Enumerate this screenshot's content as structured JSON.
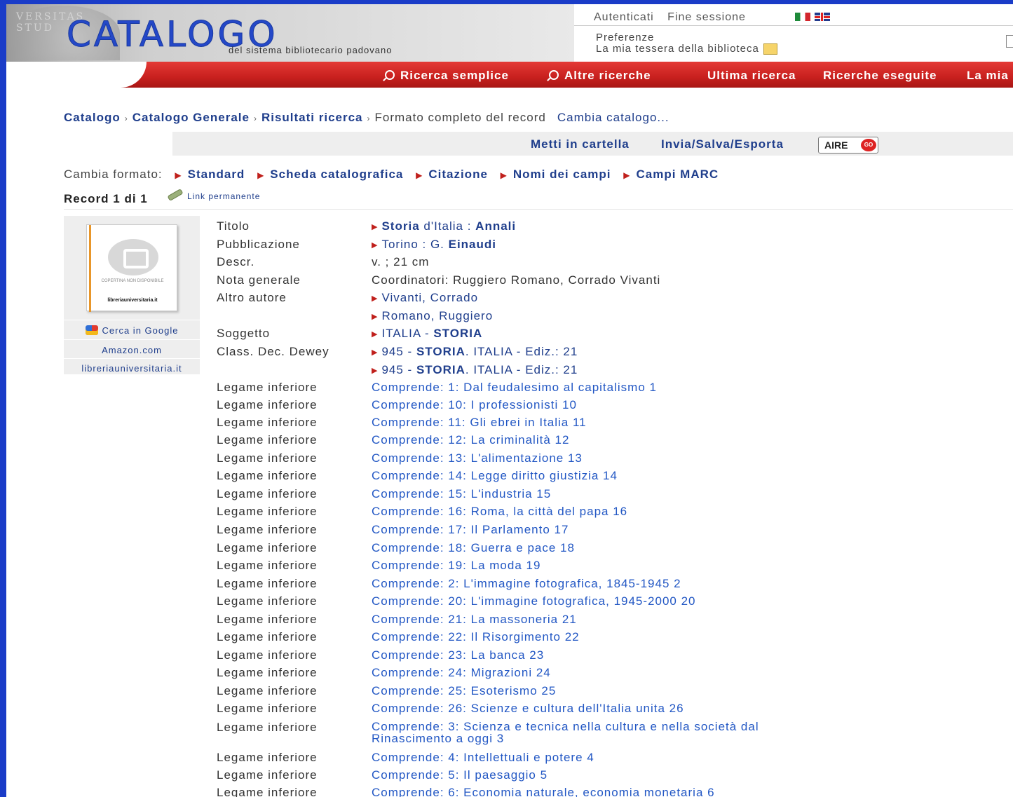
{
  "header": {
    "seal_text": "VERSITAS STUD",
    "logo_title": "CATALOGO",
    "logo_subtitle": "del sistema bibliotecario padovano",
    "top_links": [
      "Autenticati",
      "Fine sessione"
    ],
    "preferences": "Preferenze",
    "library_card": "La mia tessera della biblioteca"
  },
  "nav": {
    "items": [
      "Ricerca semplice",
      "Altre ricerche",
      "Ultima ricerca",
      "Ricerche eseguite",
      "La mia"
    ]
  },
  "breadcrumb": {
    "items": [
      "Catalogo",
      "Catalogo Generale",
      "Risultati ricerca"
    ],
    "current": "Formato completo del record",
    "change_catalog": "Cambia catalogo..."
  },
  "toolbar": {
    "folder": "Metti in cartella",
    "export": "Invia/Salva/Esporta",
    "aire": "AIRE",
    "aire_go": "GO"
  },
  "formats": {
    "label": "Cambia formato:",
    "items": [
      "Standard",
      "Scheda catalografica",
      "Citazione",
      "Nomi dei campi",
      "Campi MARC"
    ]
  },
  "record": {
    "position": "Record 1 di 1",
    "permalink": "Link permanente"
  },
  "sidebar": {
    "cover_text": "COPERTINA NON DISPONIBILE",
    "cover_brand": "libreriauniversitaria.it",
    "links": [
      "Cerca in Google",
      "Amazon.com",
      "libreriauniversitaria.it"
    ]
  },
  "fields": {
    "titolo_label": "Titolo",
    "titolo_a": "Storia",
    "titolo_b": " d'Italia : ",
    "titolo_c": "Annali",
    "pubbl_label": "Pubblicazione",
    "pubbl_a": "Torino : G. ",
    "pubbl_b": "Einaudi",
    "descr_label": "Descr.",
    "descr": "v. ; 21 cm",
    "nota_label": "Nota generale",
    "nota": "Coordinatori: Ruggiero Romano, Corrado Vivanti",
    "altro_label": "Altro autore",
    "altro_1": "Vivanti, Corrado",
    "altro_2": "Romano, Ruggiero",
    "soggetto_label": "Soggetto",
    "soggetto_a": "ITALIA - ",
    "soggetto_b": "STORIA",
    "dewey_label": "Class. Dec. Dewey",
    "dewey_a": "945 - ",
    "dewey_b": "STORIA",
    "dewey_c": ". ITALIA - Ediz.: 21",
    "dewey2_a": "945 - ",
    "dewey2_b": "STORIA",
    "dewey2_c": ". ITALIA - Ediz.: 21"
  },
  "links": {
    "label": "Legame inferiore",
    "items": [
      "Comprende: 1: Dal feudalesimo al capitalismo 1",
      "Comprende: 10: I professionisti 10",
      "Comprende: 11: Gli ebrei in Italia 11",
      "Comprende: 12: La criminalità 12",
      "Comprende: 13: L'alimentazione 13",
      "Comprende: 14: Legge diritto giustizia 14",
      "Comprende: 15: L'industria 15",
      "Comprende: 16: Roma, la città del papa 16",
      "Comprende: 17: Il Parlamento 17",
      "Comprende: 18: Guerra e pace 18",
      "Comprende: 19: La moda 19",
      "Comprende: 2: L'immagine fotografica, 1845-1945 2",
      "Comprende: 20: L'immagine fotografica, 1945-2000 20",
      "Comprende: 21: La massoneria 21",
      "Comprende: 22: Il Risorgimento 22",
      "Comprende: 23: La banca 23",
      "Comprende: 24: Migrazioni 24",
      "Comprende: 25: Esoterismo 25",
      "Comprende: 26: Scienze e cultura dell'Italia unita 26",
      "Comprende: 3: Scienza e tecnica nella cultura e nella società dal Rinascimento a oggi 3",
      "Comprende: 4: Intellettuali e potere 4",
      "Comprende: 5: Il paesaggio 5",
      "Comprende: 6: Economia naturale, economia monetaria 6"
    ]
  },
  "colors": {
    "frame": "#1a3cc8",
    "nav_red": "#c8201e",
    "link_blue": "#2257c4",
    "dark_blue": "#1f3e8c"
  }
}
